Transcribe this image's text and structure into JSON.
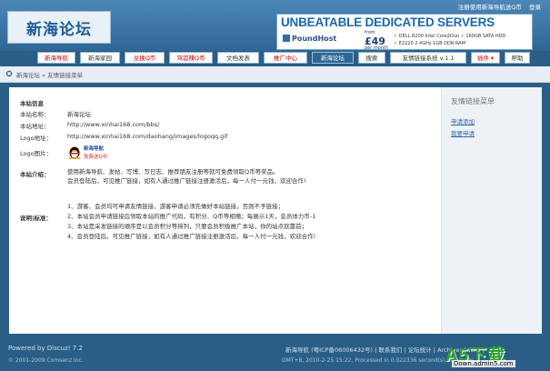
{
  "top_links": [
    "注册使用新海导航送Q币",
    "登录"
  ],
  "logo_text": "新海论坛",
  "ad": {
    "title": "UNBEATABLE DEDICATED SERVERS",
    "brand": "PoundHost",
    "price_from": "from",
    "price": "£49",
    "price_note": "per month",
    "specs_1": "✓ DELL R200 Intel Core2Duo   ✓ 160GB SATA HDD",
    "specs_2": "✓ E2220 2.4GHz 1GB DDR RAM"
  },
  "nav": [
    {
      "label": "新海导航",
      "red": true
    },
    {
      "label": "新海家园",
      "red": false
    },
    {
      "label": "兑换Q币",
      "red": true
    },
    {
      "label": "驾驭赚Q币",
      "red": true
    },
    {
      "label": "文档发表",
      "red": false
    },
    {
      "label": "推广中心",
      "red": true
    },
    {
      "label": "新海论坛",
      "red": false,
      "active": true
    },
    {
      "label": "搜索",
      "red": false
    },
    {
      "label": "友情链接系统 v.1.1",
      "red": false
    },
    {
      "label": "插件 ▾",
      "red": true
    },
    {
      "label": "帮助",
      "red": false
    }
  ],
  "breadcrumb": {
    "home": "新海论坛",
    "sep": "»",
    "current": "友情链接菜单"
  },
  "content": {
    "section_title": "本站信息",
    "name_label": "本站名称：",
    "name_value": "新海论坛",
    "url_label": "本站地址：",
    "url_value": "http://www.xinhai168.com/bbs/",
    "logo_label": "Logo地址：",
    "logo_value": "http://www.xinhai168.com/daohang/images/logoqq.gif",
    "logo_img_label": "Logo图片：",
    "badge_line1": "新海导航",
    "badge_line2": "免费送Q币",
    "intro_label": "本站介绍：",
    "intro_1": "使用新海导航、发帖、写博、写日志、推荐朋友注册等就可免费领取Q币等奖品。",
    "intro_2": "会员登陆后，可见推广链接，如有人通过推广链接注册激活后，每一人付一元钱，欢迎合作!",
    "notes_label": "说明|标准：",
    "notes": [
      "1、游客、会员均可申请友情链接，游客申请必须先做好本站链接，否则不予链接；",
      "2、本站会员申请链接后领取本站的推广代码，有积分、Q币等相赠；每展示1天，会员体力币-1",
      "3、本站是采发链接的顺序是以会员积分等排列，只要会员积极推广本站，你的站点就靠前；",
      "4、会员登陆后，可见推广链接，如有人通过推广链接注册激活后，每一人付一元钱，欢迎合作!"
    ]
  },
  "sidebar": {
    "title": "友情链接菜单",
    "links": [
      "申请添加",
      "我要申请"
    ]
  },
  "footer": {
    "powered": "Powered by Discuz! 7.2",
    "copyright": "© 2001-2009 Comsenz Inc.",
    "right_line1": "新海导航 (粤ICP备06006432号) | 联系我们 | 论坛统计 | Archiver | WAP |",
    "right_line2": "GMT+8, 2010-2-25 15:22, Processed in 0.022336 second(s), 3 queries"
  },
  "watermark": {
    "main": "A5下载",
    "sub": "Down.admin5.com"
  },
  "colors": {
    "header_blue": "#2f6696",
    "nav_red": "#cc0000",
    "link_blue": "#3366aa"
  }
}
